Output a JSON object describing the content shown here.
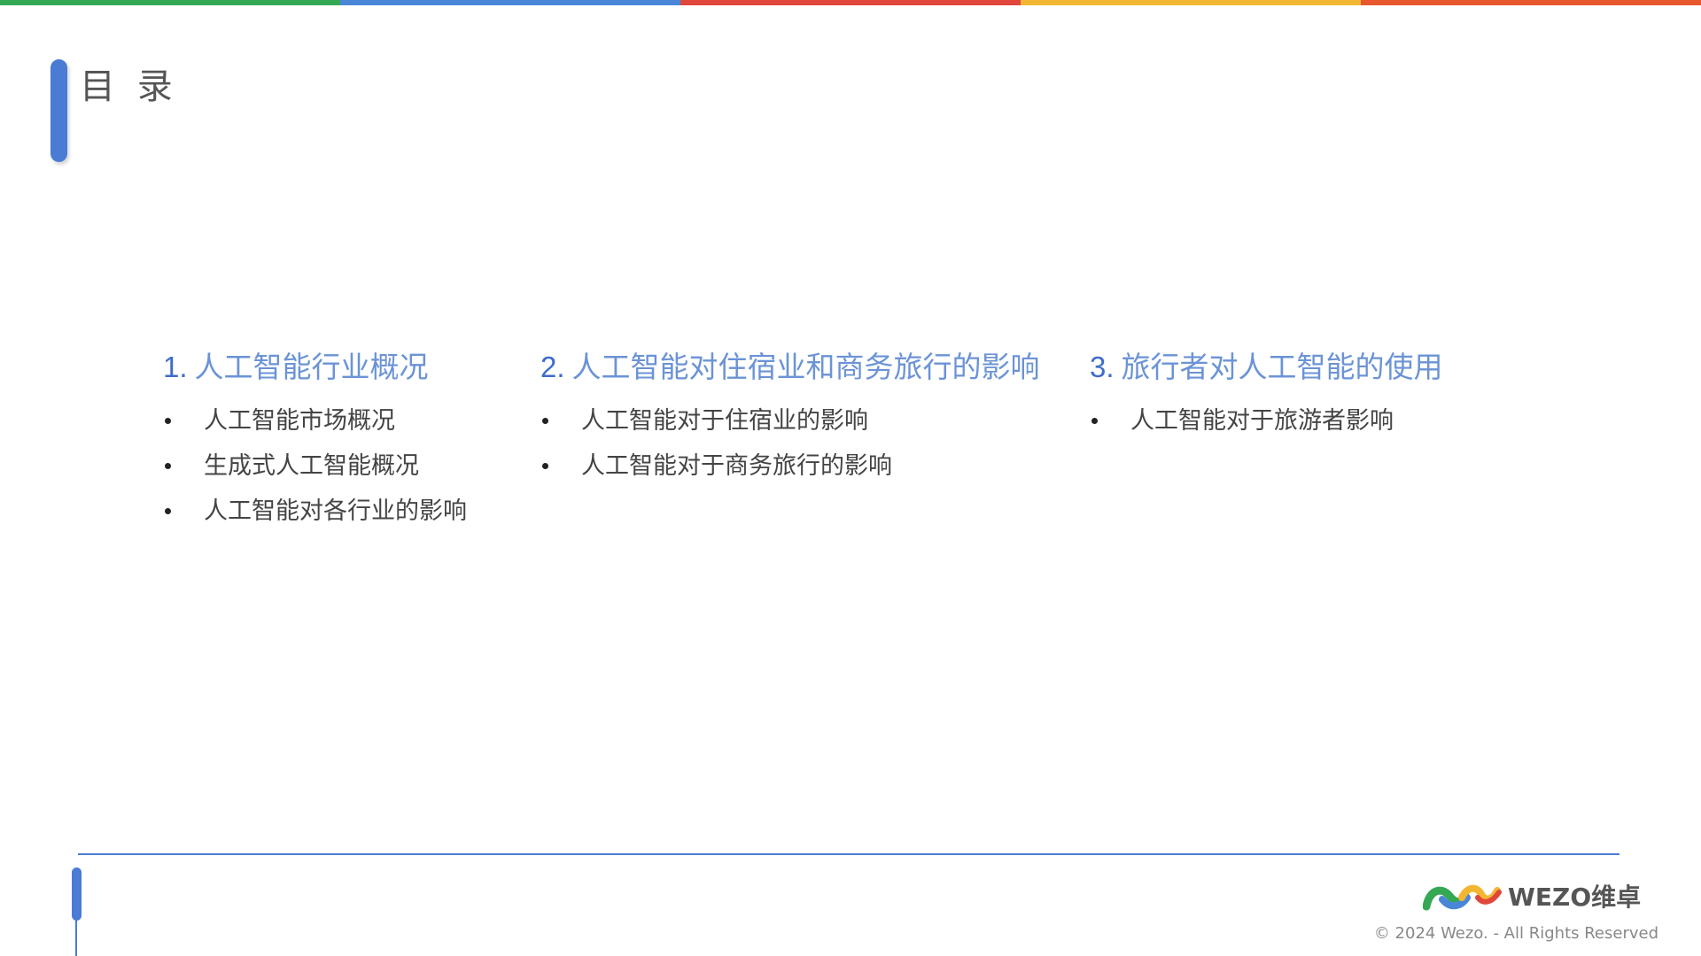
{
  "colors": {
    "accent": "#4a7bd5",
    "heading": "#6b93d6",
    "heading_number": "#3d6cc8",
    "stripe": [
      "#34a853",
      "#4a86d8",
      "#e0463a",
      "#f3b632",
      "#e8582f"
    ]
  },
  "page": {
    "title": "目 录"
  },
  "sections": [
    {
      "number": "1.",
      "title": "人工智能行业概况",
      "items": [
        "人工智能市场概况",
        "生成式人工智能概况",
        "人工智能对各行业的影响"
      ]
    },
    {
      "number": "2.",
      "title": "人工智能对住宿业和商务旅行的影响",
      "items": [
        "人工智能对于住宿业的影响",
        "人工智能对于商务旅行的影响"
      ]
    },
    {
      "number": "3.",
      "title": "旅行者对人工智能的使用",
      "items": [
        "人工智能对于旅游者影响"
      ]
    }
  ],
  "footer": {
    "logo_text": "WEZO维卓",
    "logo_icon": "wezo-wave-logo-icon",
    "copyright": "© 2024 Wezo. - All Rights Reserved"
  }
}
